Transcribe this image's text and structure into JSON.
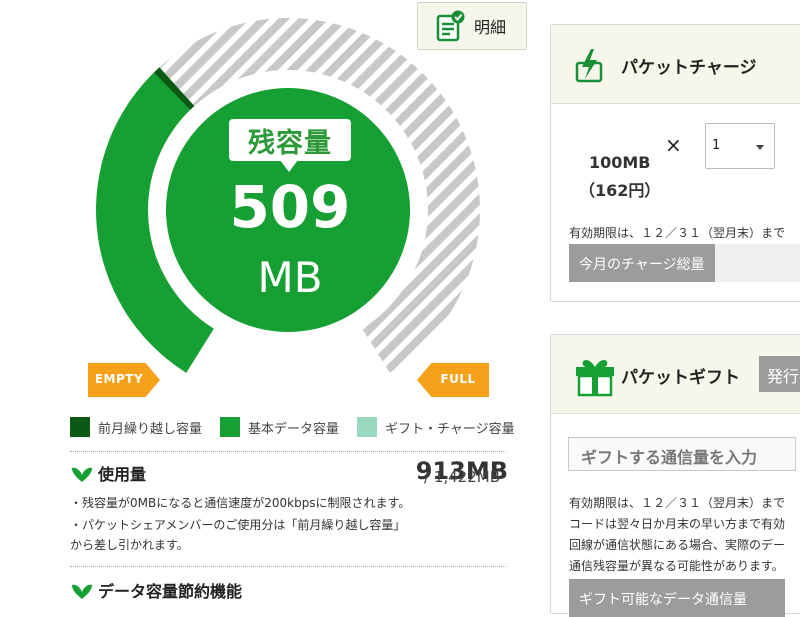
{
  "header": {
    "meisai_label": "明細"
  },
  "gauge": {
    "title": "残容量",
    "value": "509",
    "unit": "MB",
    "remaining_mb": 509,
    "carryover_mb": 0,
    "full_mb": 1422,
    "empty_label": "EMPTY",
    "full_label": "FULL"
  },
  "legend": [
    {
      "label": "前月繰り越し容量",
      "color": "#0a5a14"
    },
    {
      "label": "基本データ容量",
      "color": "#16a034"
    },
    {
      "label": "ギフト・チャージ容量",
      "color": "#98d9c0"
    }
  ],
  "usage": {
    "title": "使用量",
    "value": "913MB",
    "total": "/ 1,422MB",
    "note1": "・残容量が0MBになると通信速度が200kbpsに制限されます。",
    "note2a": "・パケットシェアメンバーのご使用分は「前月繰り越し容量」",
    "note2b": "から差し引かれます。"
  },
  "saving": {
    "title": "データ容量節約機能"
  },
  "charge": {
    "title": "パケットチャージ",
    "item_size": "100MB",
    "item_price": "（162円）",
    "times": "×",
    "qty": "1",
    "expiry": "有効期限は、１２／３１（翌月末）まで",
    "total_label": "今月のチャージ総量"
  },
  "gift": {
    "title": "パケットギフト",
    "issue_label": "発行",
    "input_label": "ギフトする通信量を入力",
    "expiry": "有効期限は、１２／３１（翌月末）まで",
    "line2": "コードは翌々日か月末の早い方まで有効",
    "line3": "回線が通信状態にある場合、実際のデー",
    "line4": "通信残容量が異なる可能性があります。",
    "available_label": "ギフト可能なデータ通信量"
  },
  "colors": {
    "accent_green": "#16a034",
    "dark_green": "#0a5a14",
    "orange": "#f6a11a",
    "stripe_gray": "#c8c8c8"
  }
}
